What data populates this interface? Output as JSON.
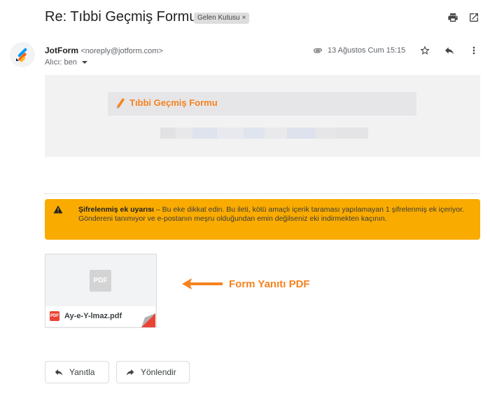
{
  "message": {
    "subject": "Re: Tıbbi Geçmiş Formu",
    "label": "Gelen Kutusu",
    "label_close": "×"
  },
  "toolbar_icons": [
    "print-icon",
    "open-in-new-window-icon"
  ],
  "sender": {
    "name": "JotForm",
    "email": "<noreply@jotform.com>",
    "recipient_label": "Alıcı: ben",
    "date": "13 Ağustos Cum 15:15"
  },
  "header_icons": [
    "paperclip-icon",
    "star-icon",
    "reply-icon",
    "more-vert-icon"
  ],
  "email_body": {
    "form_title": "Tıbbi Geçmiş Formu"
  },
  "warning": {
    "title": "Şifrelenmiş ek uyarısı",
    "text": " – Bu eke dikkat edin. Bu ileti, kötü amaçlı içerik taraması yapılamayan 1 şifrelenmiş ek içeriyor. Göndereni tanımıyor ve e-postanın meşru olduğundan emin değilseniz eki indirmekten kaçının."
  },
  "attachment": {
    "thumb_label": "PDF",
    "badge_label": "PDF",
    "filename": "Ay-e-Y-lmaz.pdf"
  },
  "callout": {
    "text": "Form Yanıtı PDF"
  },
  "actions": {
    "reply_label": "Yanıtla",
    "forward_label": "Yönlendir"
  },
  "colors": {
    "warning_bg": "#f9ab00",
    "brand_orange": "#f5821f",
    "pdf_red": "#ea4335"
  }
}
